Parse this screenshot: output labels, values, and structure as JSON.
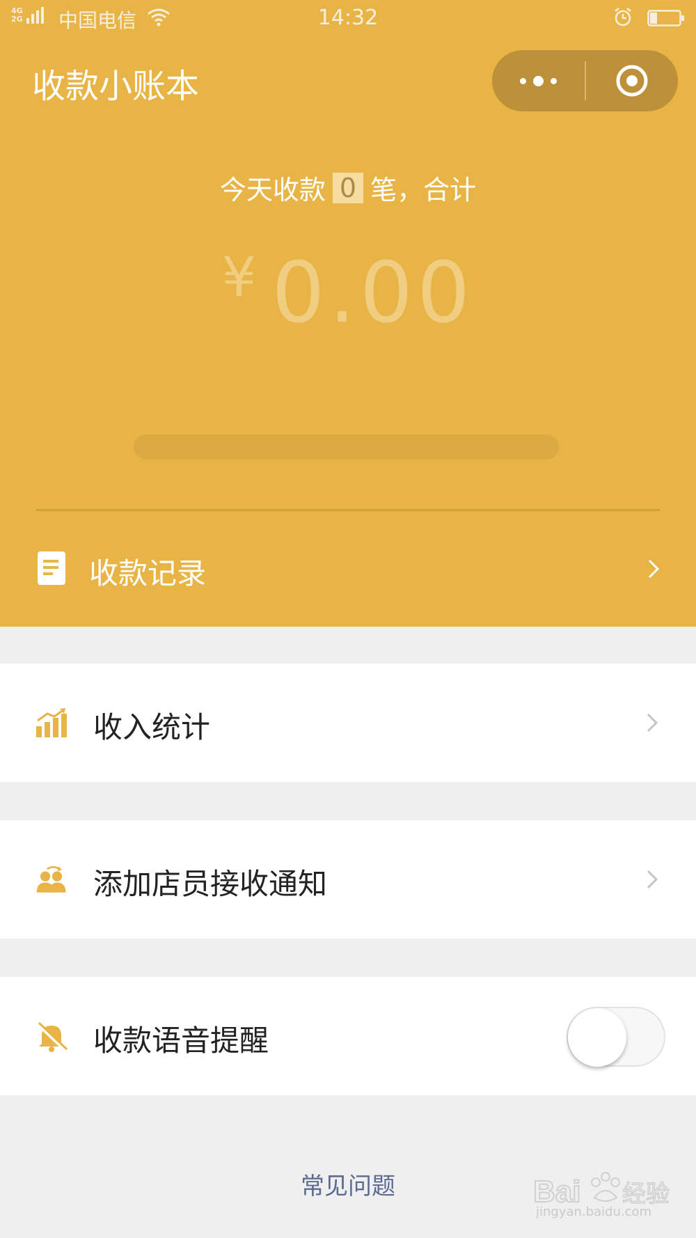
{
  "status_bar": {
    "network_top": "4G",
    "network_bottom": "2G",
    "carrier": "中国电信",
    "time": "14:32",
    "icons": [
      "signal-icon",
      "wifi-icon",
      "alarm-icon",
      "battery-icon"
    ],
    "battery_level": 0.25
  },
  "header": {
    "app_title": "收款小账本",
    "capsule": {
      "more_icon": "more-dots-icon",
      "close_icon": "target-circle-icon"
    },
    "summary_prefix": "今天收款",
    "summary_count": "0",
    "summary_suffix": "笔，合计",
    "currency_symbol": "¥",
    "amount": "0.00",
    "records_label": "收款记录",
    "records_icon": "document-icon"
  },
  "menu": {
    "income_stats": {
      "label": "收入统计",
      "icon": "bar-chart-icon"
    },
    "add_staff": {
      "label": "添加店员接收通知",
      "icon": "people-icon"
    },
    "voice_alert": {
      "label": "收款语音提醒",
      "icon": "bell-off-icon",
      "enabled": false
    }
  },
  "footer": {
    "faq_label": "常见问题",
    "watermark_text": "jingyan.baidu.com"
  },
  "colors": {
    "brand": "#e7b445",
    "capsule": "#bd9139",
    "background": "#efeff0",
    "link": "#5c6b94",
    "icon": "#e7b445"
  }
}
